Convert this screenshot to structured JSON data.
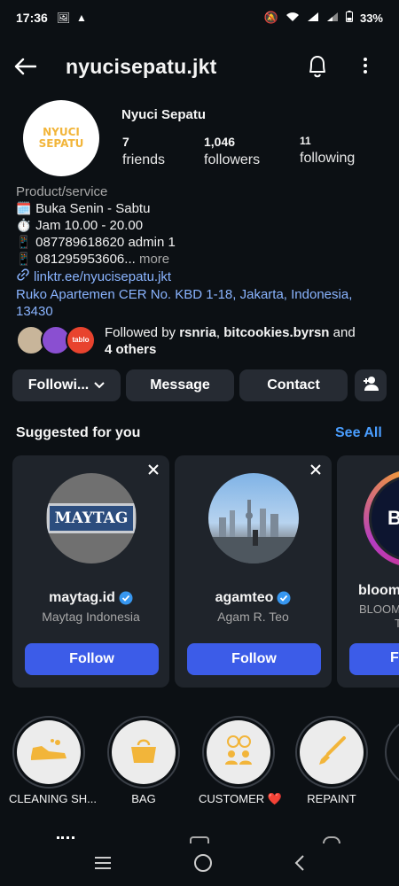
{
  "status_bar": {
    "time": "17:36",
    "battery": "33%"
  },
  "header": {
    "username": "nyucisepatu.jkt"
  },
  "profile": {
    "avatar_text_1": "NYUCI",
    "avatar_text_2": "SEPATU",
    "display_name": "Nyuci Sepatu",
    "stats": [
      {
        "value": "7",
        "label": "friends"
      },
      {
        "value": "1,046",
        "label": "followers"
      },
      {
        "value": "11",
        "label": "following"
      }
    ],
    "category": "Product/service",
    "bio_lines": [
      {
        "emoji": "🗓️",
        "text": "Buka Senin - Sabtu"
      },
      {
        "emoji": "⏱️",
        "text": "Jam 10.00 - 20.00"
      },
      {
        "emoji": "📱",
        "text": "087789618620 admin 1"
      },
      {
        "emoji": "📱",
        "text": "081295953606..."
      }
    ],
    "more_label": "more",
    "link": "linktr.ee/nyucisepatu.jkt",
    "address": "Ruko Apartemen CER No. KBD 1-18, Jakarta, Indonesia, 13430",
    "followed_by": {
      "prefix": "Followed by ",
      "user1": "rsnria",
      "separator": ", ",
      "user2": "bitcookies.byrsn",
      "and_text": " and",
      "others": "4 others",
      "mini3_text": "tablo"
    }
  },
  "actions": {
    "following_label": "Followi...",
    "message_label": "Message",
    "contact_label": "Contact"
  },
  "suggested": {
    "title": "Suggested for you",
    "see_all": "See All",
    "cards": [
      {
        "name": "maytag.id",
        "subtitle": "Maytag Indonesia",
        "follow": "Follow",
        "logo_text": "MAYTAG"
      },
      {
        "name": "agamteo",
        "subtitle": "Agam R. Teo",
        "follow": "Follow"
      },
      {
        "name": "bloom",
        "subtitle_1": "BLOOM",
        "subtitle_2": "T",
        "follow": "F",
        "logo_text": "BL"
      }
    ]
  },
  "highlights": [
    {
      "label": "CLEANING SH..."
    },
    {
      "label": "BAG"
    },
    {
      "label": "CUSTOMER ❤️"
    },
    {
      "label": "REPAINT"
    },
    {
      "label": ""
    }
  ],
  "colors": {
    "background": "#0c1014",
    "button": "#262b33",
    "follow_blue": "#3c5ce8",
    "link_blue": "#8ab4ff",
    "highlight_orange": "#f2b53a"
  }
}
